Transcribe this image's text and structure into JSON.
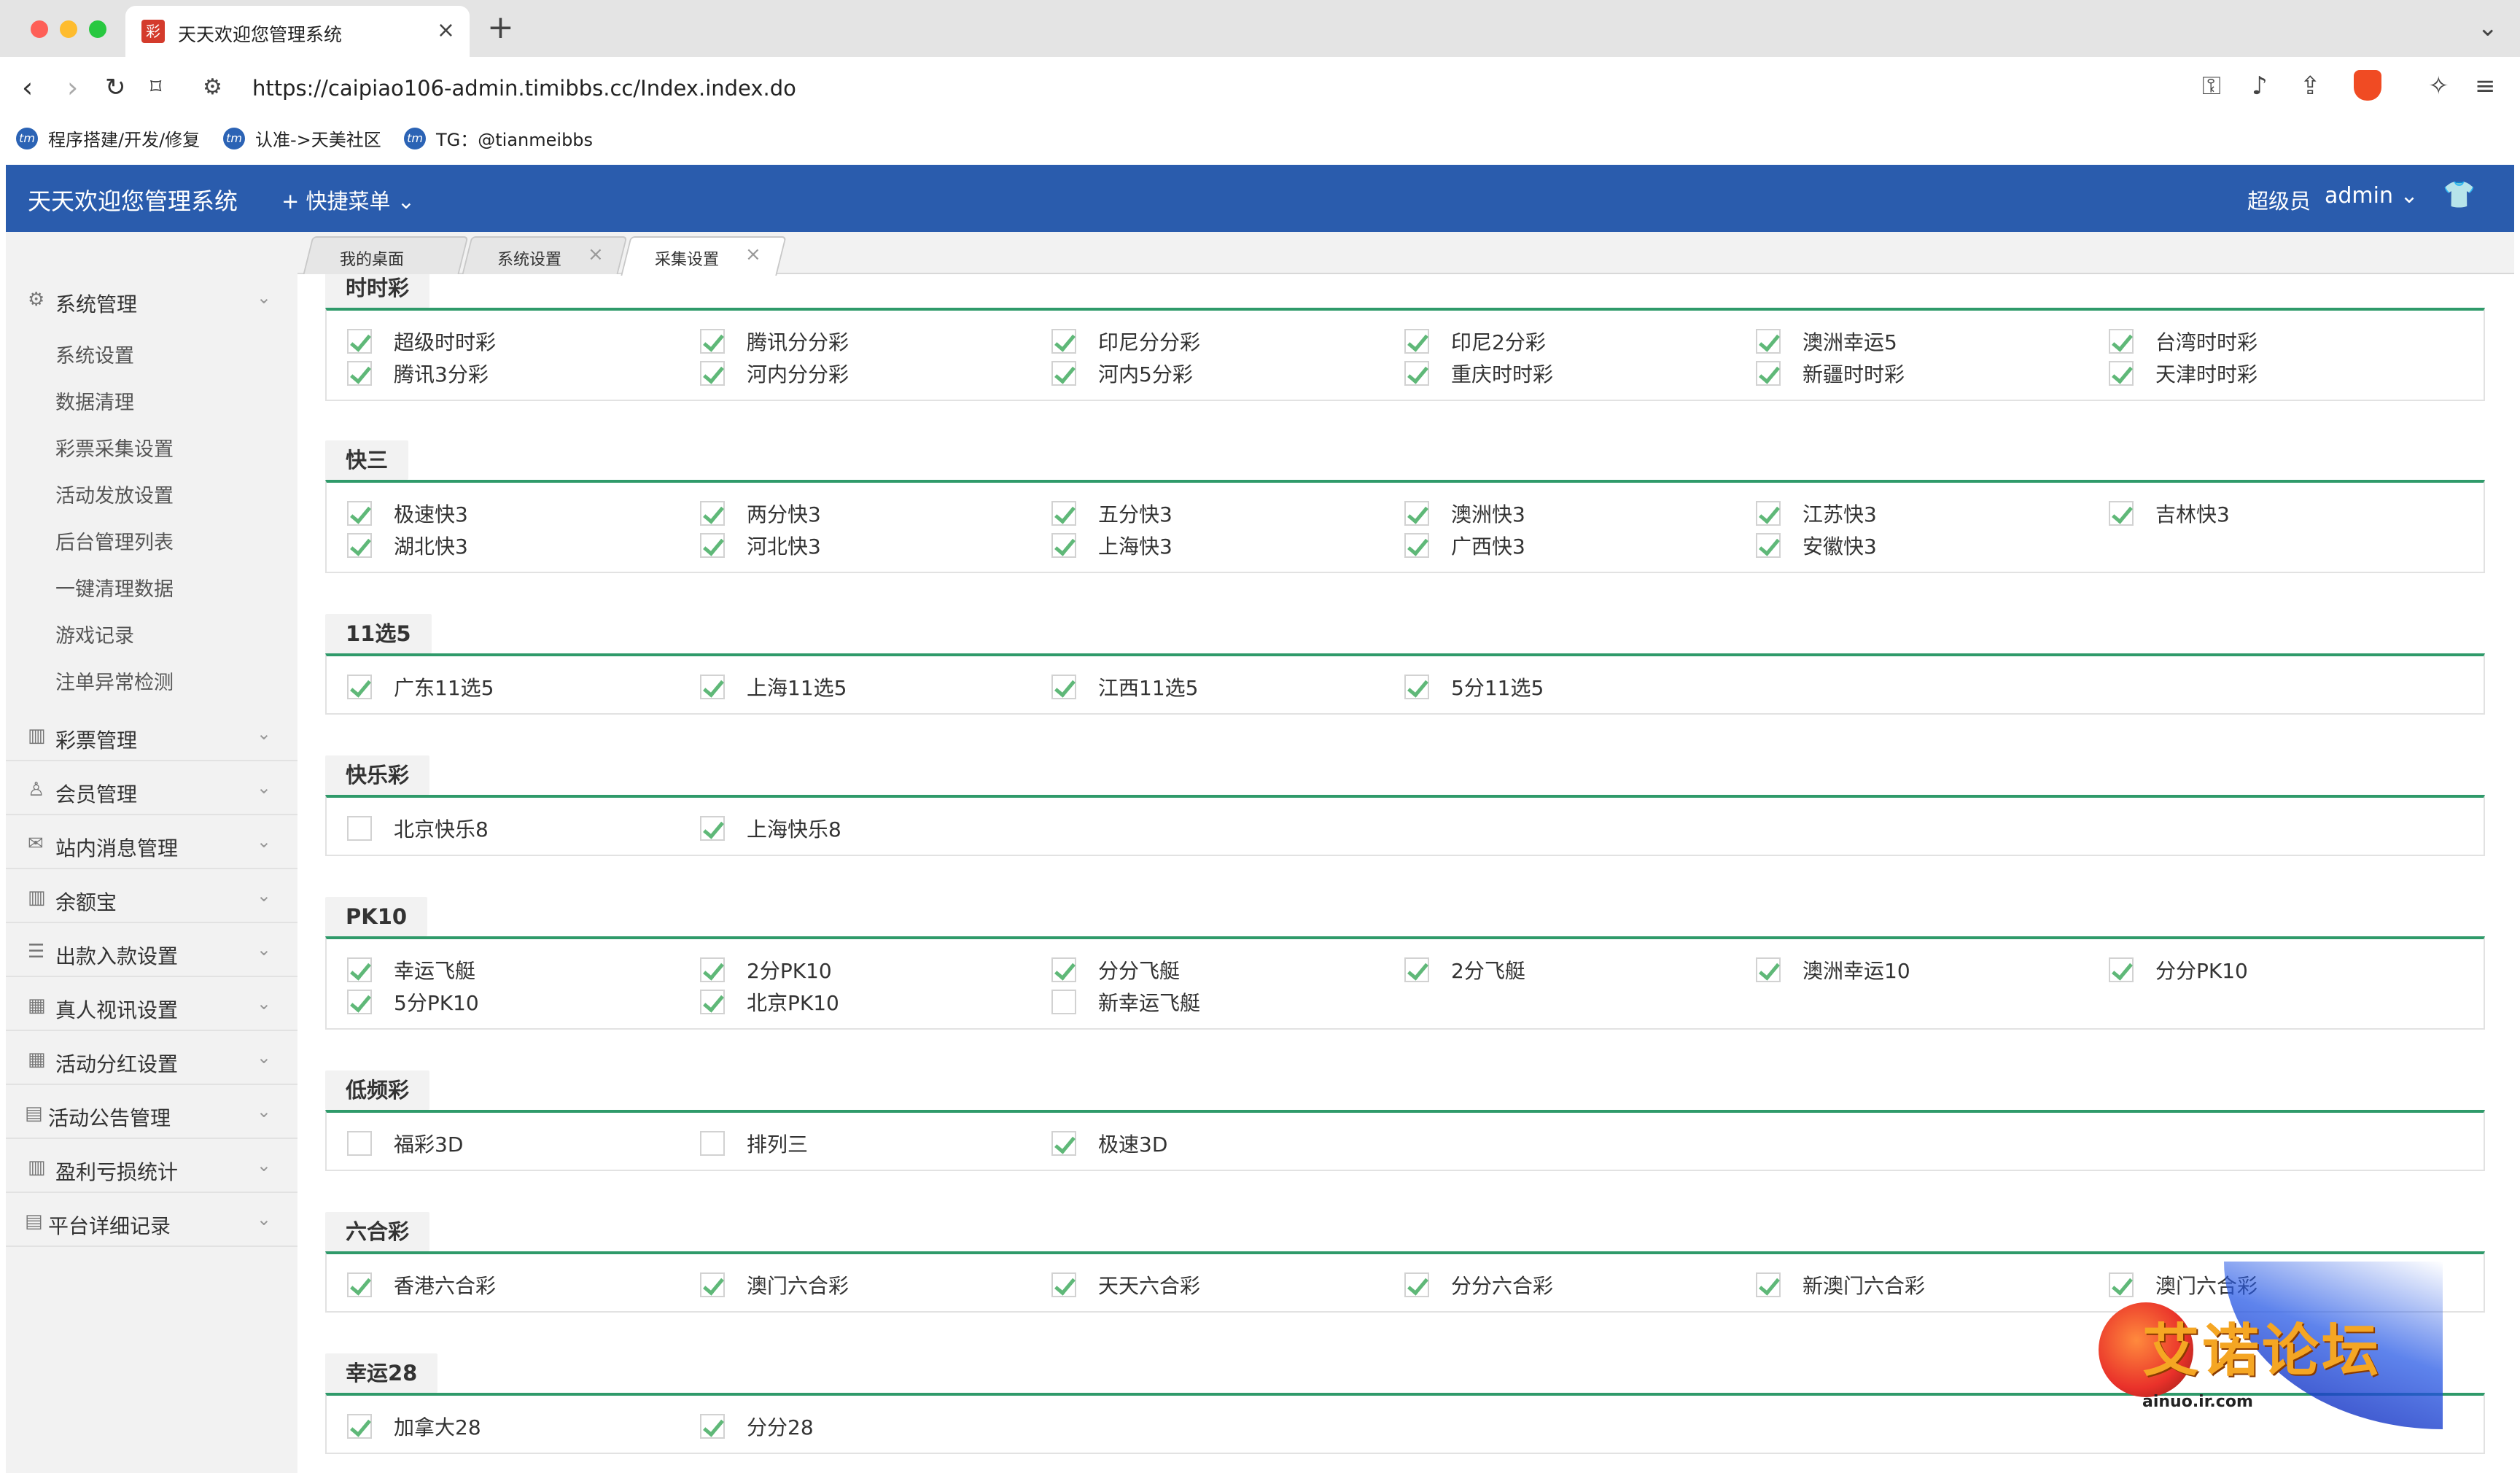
{
  "browser": {
    "tab_title": "天天欢迎您管理系统",
    "tab_favicon": "彩",
    "url": "https://caipiao106-admin.timibbs.cc/Index.index.do",
    "bookmarks": [
      {
        "label": "程序搭建/开发/修复"
      },
      {
        "label": "认准->天美社区"
      },
      {
        "label": "TG：@tianmeibbs"
      }
    ],
    "bookmark_icon_text": "tm"
  },
  "header": {
    "title": "天天欢迎您管理系统",
    "quick_menu": "快捷菜单",
    "user_role": "超级员",
    "user_name": "admin"
  },
  "sidebar": {
    "groups": [
      {
        "label": "系统管理",
        "icon": "gear-icon",
        "expanded": true,
        "items": [
          "系统设置",
          "数据清理",
          "彩票采集设置",
          "活动发放设置",
          "后台管理列表",
          "一键清理数据",
          "游戏记录",
          "注单异常检测"
        ]
      },
      {
        "label": "彩票管理",
        "icon": "chart-icon"
      },
      {
        "label": "会员管理",
        "icon": "user-icon"
      },
      {
        "label": "站内消息管理",
        "icon": "mail-icon"
      },
      {
        "label": "余额宝",
        "icon": "chart-icon"
      },
      {
        "label": "出款入款设置",
        "icon": "list-icon"
      },
      {
        "label": "真人视讯设置",
        "icon": "grid-icon"
      },
      {
        "label": "活动分红设置",
        "icon": "grid-icon"
      },
      {
        "label": "活动公告管理",
        "icon": "doc-icon"
      },
      {
        "label": "盈利亏损统计",
        "icon": "chart-icon"
      },
      {
        "label": "平台详细记录",
        "icon": "doc-icon"
      }
    ]
  },
  "content_tabs": [
    {
      "label": "我的桌面",
      "closable": false
    },
    {
      "label": "系统设置",
      "closable": true
    },
    {
      "label": "采集设置",
      "closable": true,
      "active": true
    }
  ],
  "sections": [
    {
      "title": "时时彩",
      "items": [
        {
          "label": "超级时时彩",
          "checked": true
        },
        {
          "label": "腾讯分分彩",
          "checked": true
        },
        {
          "label": "印尼分分彩",
          "checked": true
        },
        {
          "label": "印尼2分彩",
          "checked": true
        },
        {
          "label": "澳洲幸运5",
          "checked": true
        },
        {
          "label": "台湾时时彩",
          "checked": true
        },
        {
          "label": "腾讯3分彩",
          "checked": true
        },
        {
          "label": "河内分分彩",
          "checked": true
        },
        {
          "label": "河内5分彩",
          "checked": true
        },
        {
          "label": "重庆时时彩",
          "checked": true
        },
        {
          "label": "新疆时时彩",
          "checked": true
        },
        {
          "label": "天津时时彩",
          "checked": true
        }
      ]
    },
    {
      "title": "快三",
      "items": [
        {
          "label": "极速快3",
          "checked": true
        },
        {
          "label": "两分快3",
          "checked": true
        },
        {
          "label": "五分快3",
          "checked": true
        },
        {
          "label": "澳洲快3",
          "checked": true
        },
        {
          "label": "江苏快3",
          "checked": true
        },
        {
          "label": "吉林快3",
          "checked": true
        },
        {
          "label": "湖北快3",
          "checked": true
        },
        {
          "label": "河北快3",
          "checked": true
        },
        {
          "label": "上海快3",
          "checked": true
        },
        {
          "label": "广西快3",
          "checked": true
        },
        {
          "label": "安徽快3",
          "checked": true
        }
      ]
    },
    {
      "title": "11选5",
      "items": [
        {
          "label": "广东11选5",
          "checked": true
        },
        {
          "label": "上海11选5",
          "checked": true
        },
        {
          "label": "江西11选5",
          "checked": true
        },
        {
          "label": "5分11选5",
          "checked": true
        }
      ]
    },
    {
      "title": "快乐彩",
      "items": [
        {
          "label": "北京快乐8",
          "checked": false
        },
        {
          "label": "上海快乐8",
          "checked": true
        }
      ]
    },
    {
      "title": "PK10",
      "items": [
        {
          "label": "幸运飞艇",
          "checked": true
        },
        {
          "label": "2分PK10",
          "checked": true
        },
        {
          "label": "分分飞艇",
          "checked": true
        },
        {
          "label": "2分飞艇",
          "checked": true
        },
        {
          "label": "澳洲幸运10",
          "checked": true
        },
        {
          "label": "分分PK10",
          "checked": true
        },
        {
          "label": "5分PK10",
          "checked": true
        },
        {
          "label": "北京PK10",
          "checked": true
        },
        {
          "label": "新幸运飞艇",
          "checked": false
        }
      ]
    },
    {
      "title": "低频彩",
      "items": [
        {
          "label": "福彩3D",
          "checked": false
        },
        {
          "label": "排列三",
          "checked": false
        },
        {
          "label": "极速3D",
          "checked": true
        }
      ]
    },
    {
      "title": "六合彩",
      "items": [
        {
          "label": "香港六合彩",
          "checked": true
        },
        {
          "label": "澳门六合彩",
          "checked": true
        },
        {
          "label": "天天六合彩",
          "checked": true
        },
        {
          "label": "分分六合彩",
          "checked": true
        },
        {
          "label": "新澳门六合彩",
          "checked": true
        },
        {
          "label": "澳门六合彩",
          "checked": true
        }
      ]
    },
    {
      "title": "幸运28",
      "items": [
        {
          "label": "加拿大28",
          "checked": true
        },
        {
          "label": "分分28",
          "checked": true
        }
      ]
    }
  ],
  "watermark": {
    "text": "艾诺论坛",
    "url": "ainuo.ir.com"
  },
  "colors": {
    "header_bg": "#2a5cad",
    "accent_green": "#2f9a6a",
    "check_green": "#5fb878"
  }
}
